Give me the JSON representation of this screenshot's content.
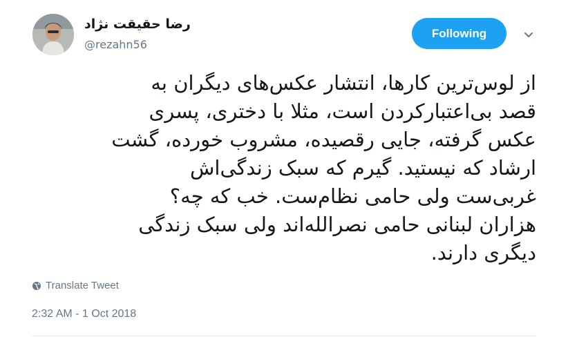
{
  "user": {
    "display_name": "رضا حقیقت نژاد",
    "handle": "@rezahn56"
  },
  "follow_button": {
    "label": "Following",
    "color": "#1da1f2"
  },
  "menu": {
    "icon": "chevron-down-icon"
  },
  "tweet": {
    "lines": [
      "از لوس‌ترین کارها، انتشار عکس‌های دیگران به",
      "قصد بی‌اعتبارکردن است، مثلا با دختری، پسری",
      "عکس گرفته، جایی رقصیده، مشروب خورده، گشت",
      "ارشاد که نیستید. گیرم که سبک زندگی‌اش",
      "غربی‌ست ولی حامی نظام‌ست. خب که چه؟",
      "هزاران لبنانی حامی نصرالله‌اند ولی سبک زندگی",
      "دیگری دارند."
    ]
  },
  "translate": {
    "label": "Translate Tweet",
    "icon": "globe-icon"
  },
  "meta": {
    "timestamp": "2:32 AM - 1 Oct 2018"
  }
}
